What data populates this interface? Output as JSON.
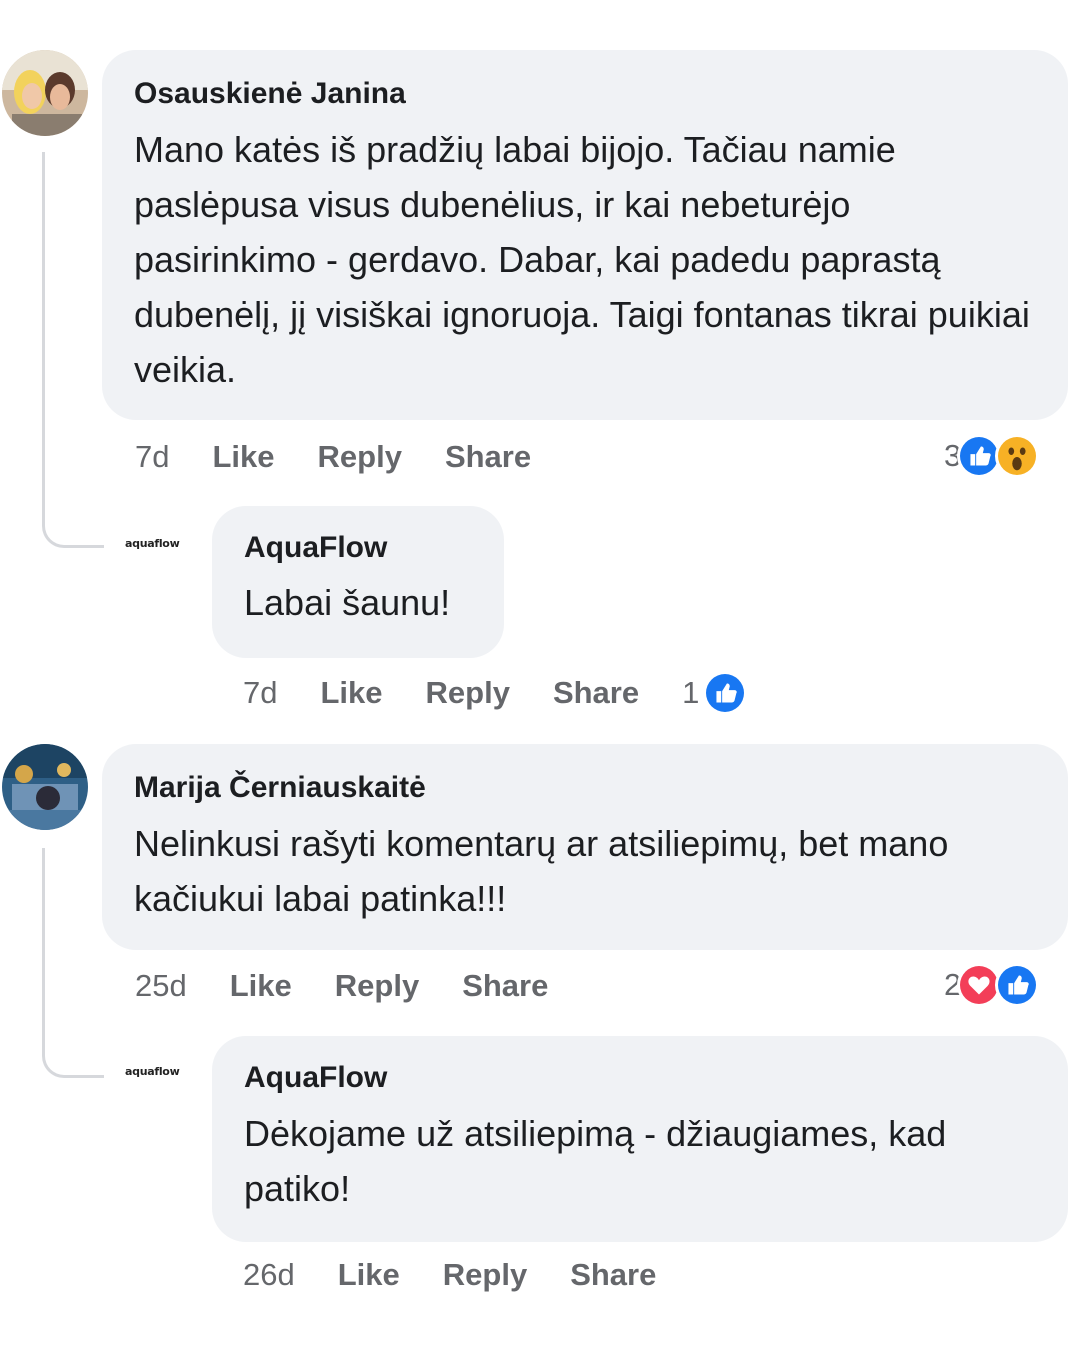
{
  "actions": {
    "like": "Like",
    "reply": "Reply",
    "share": "Share"
  },
  "comments": [
    {
      "author": "Osauskienė Janina",
      "text": "Mano katės iš pradžių labai bijojo. Tačiau namie paslėpusa visus dubenėlius, ir kai nebeturėjo pasirinkimo - gerdavo. Dabar, kai padedu paprastą dubenėlį, jį visiškai ignoruoja. Taigi fontanas tikrai puikiai veikia.",
      "age": "7d",
      "reaction_count": "3",
      "reactions": [
        "like-icon",
        "wow-icon"
      ],
      "reply": {
        "brand": "aquaflow",
        "author": "AquaFlow",
        "text": "Labai šaunu!",
        "age": "7d",
        "reaction_count": "1",
        "reactions": [
          "like-icon"
        ]
      }
    },
    {
      "author": "Marija Černiauskaitė",
      "text": "Nelinkusi rašyti komentarų ar atsiliepimų, bet mano kačiukui labai patinka!!!",
      "age": "25d",
      "reaction_count": "2",
      "reactions": [
        "love-icon",
        "like-icon"
      ],
      "reply": {
        "brand": "aquaflow",
        "author": "AquaFlow",
        "text": "Dėkojame už atsiliepimą - džiaugiames, kad patiko!",
        "age": "26d"
      }
    }
  ],
  "colors": {
    "bubble": "#f0f2f5",
    "meta": "#65676b",
    "like": "#1877f2",
    "love": "#f33e58",
    "wow": "#f7b125"
  }
}
